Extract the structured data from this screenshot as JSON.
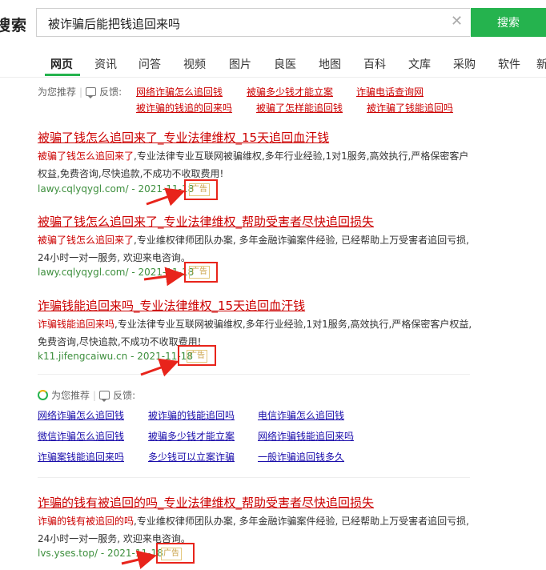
{
  "header": {
    "logo": "搜索",
    "query": "被诈骗后能把钱追回来吗",
    "clear_icon": "close-icon",
    "search_label": "搜索",
    "accent": "#25b34e"
  },
  "nav": {
    "tabs": [
      "网页",
      "资讯",
      "问答",
      "视频",
      "图片",
      "良医",
      "地图",
      "百科",
      "文库",
      "采购",
      "软件",
      "新"
    ]
  },
  "top_rec": {
    "label": "为您推荐",
    "feedback": "反馈:",
    "links": [
      "网络诈骗怎么追回钱",
      "被骗多少钱才能立案",
      "诈骗电话查询网",
      "被诈骗的钱追的回来吗",
      "被骗了怎样能追回钱",
      "被诈骗了钱能追回吗"
    ]
  },
  "results": [
    {
      "title": "被骗了钱怎么追回来了_专业法律维权_15天追回血汗钱",
      "desc_hl": "被骗了钱怎么追回来了",
      "desc_rest": ",专业法律专业互联网被骗维权,多年行业经验,1对1服务,高效执行,严格保密客户权益,免费咨询,尽快追款,不成功不收取费用!",
      "url": "lawy.cqlyqygl.com/ - 2021-11-18",
      "ad": "广告"
    },
    {
      "title": "被骗了钱怎么追回来了_专业法律维权_帮助受害者尽快追回损失",
      "desc_hl": "被骗了钱怎么追回来了",
      "desc_rest": ",专业维权律师团队办案, 多年金融诈骗案件经验, 已经帮助上万受害者追回亏损, 24小时一对一服务, 欢迎来电咨询。",
      "url": "lawy.cqlyqygl.com/ - 2021-11-18",
      "ad": "广告"
    },
    {
      "title": "诈骗钱能追回来吗_专业法律维权_15天追回血汗钱",
      "desc_hl": "诈骗钱能追回来吗",
      "desc_rest": ",专业法律专业互联网被骗维权,多年行业经验,1对1服务,高效执行,严格保密客户权益,免费咨询,尽快追款,不成功不收取费用!",
      "url": "k11.jifengcaiwu.cn - 2021-11-18",
      "ad": "广告"
    },
    {
      "title": "诈骗的钱有被追回的吗_专业法律维权_帮助受害者尽快追回损失",
      "desc_hl": "诈骗的钱有被追回的吗",
      "desc_rest": ",专业维权律师团队办案, 多年金融诈骗案件经验, 已经帮助上万受害者追回亏损, 24小时一对一服务, 欢迎来电咨询。",
      "url": "lvs.yses.top/ - 2021-11-18",
      "ad": "广告"
    }
  ],
  "mid_rec": {
    "label": "为您推荐",
    "feedback": "反馈:",
    "links": [
      "网络诈骗怎么追回钱",
      "被诈骗的钱能追回吗",
      "电信诈骗怎么追回钱",
      "微信诈骗怎么追回钱",
      "被骗多少钱才能立案",
      "网络诈骗钱能追回来吗",
      "诈骗案钱能追回来吗",
      "多少钱可以立案诈骗",
      "一般诈骗追回钱多久"
    ]
  }
}
